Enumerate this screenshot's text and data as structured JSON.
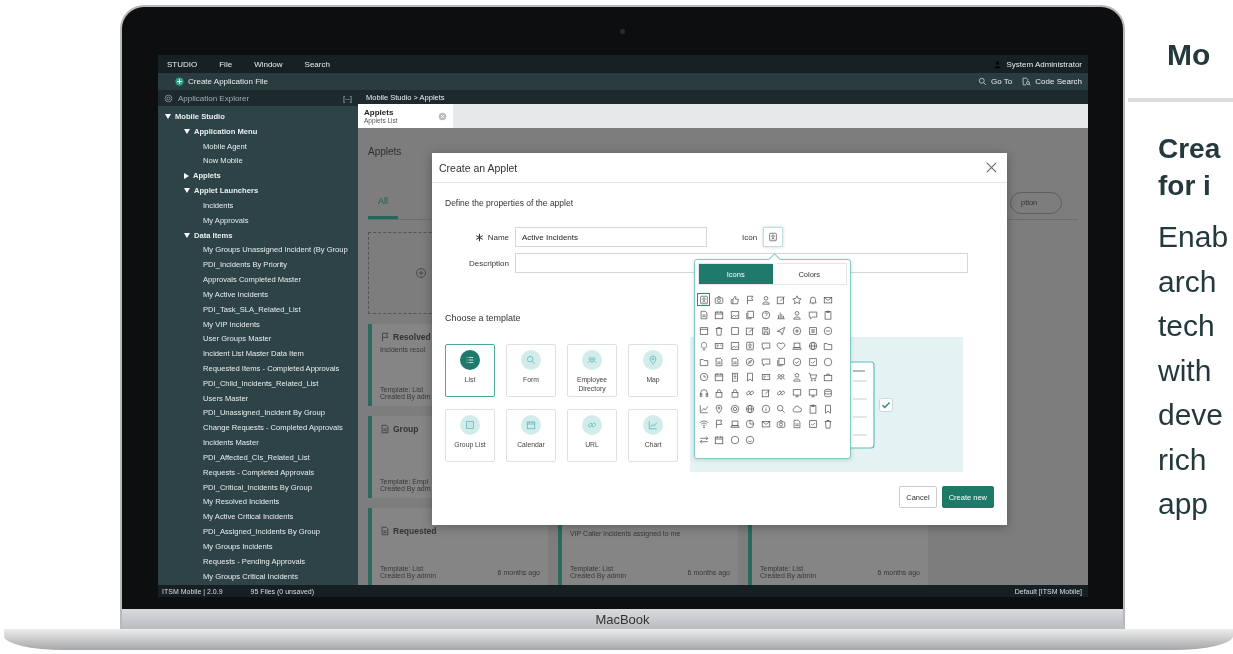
{
  "menu_bar": {
    "items": [
      "STUDIO",
      "File",
      "Window",
      "Search"
    ],
    "user": "System Administrator"
  },
  "toolbar": {
    "create": "Create Application File",
    "actions": [
      {
        "kind": "search",
        "label": "Go To"
      },
      {
        "kind": "code-search",
        "label": "Code Search"
      }
    ]
  },
  "explorer": {
    "title": "Application Explorer",
    "collapse": "[–]",
    "tree": [
      {
        "label": "Mobile Studio",
        "expanded": true,
        "children": [
          {
            "label": "Application Menu",
            "expanded": true,
            "children": [
              {
                "label": "Mobile Agent"
              },
              {
                "label": "Now Mobile"
              }
            ]
          },
          {
            "label": "Applets",
            "expanded": false
          },
          {
            "label": "Applet Launchers",
            "expanded": true,
            "children": [
              {
                "label": "Incidents"
              },
              {
                "label": "My Approvals"
              }
            ]
          },
          {
            "label": "Data Items",
            "expanded": true,
            "children": [
              {
                "label": "My Groups Unassigned Incident (By Group"
              },
              {
                "label": "PDI_Incidents By Priority"
              },
              {
                "label": "Approvals Completed Master"
              },
              {
                "label": "My Active Incidents"
              },
              {
                "label": "PDI_Task_SLA_Related_List"
              },
              {
                "label": "My VIP Incidents"
              },
              {
                "label": "User Groups Master"
              },
              {
                "label": "Incident List Master Data Item"
              },
              {
                "label": "Requested Items - Completed Approvals"
              },
              {
                "label": "PDI_Child_Incidents_Related_List"
              },
              {
                "label": "Users Master"
              },
              {
                "label": "PDI_Unassigned_Incident By Group"
              },
              {
                "label": "Change Requests - Completed Approvals"
              },
              {
                "label": "Incidents Master"
              },
              {
                "label": "PDI_Affected_CIs_Related_List"
              },
              {
                "label": "Requests - Completed Approvals"
              },
              {
                "label": "PDI_Critical_Incidents By Group"
              },
              {
                "label": "My Resolved Incidents"
              },
              {
                "label": "My Active Critical Incidents"
              },
              {
                "label": "PDI_Assigned_Incidents By Group"
              },
              {
                "label": "My Groups Incidents"
              },
              {
                "label": "Requests - Pending Approvals"
              },
              {
                "label": "My Groups Critical Incidents"
              }
            ]
          }
        ]
      }
    ]
  },
  "breadcrumb": "Mobile Studio > Applets",
  "tabs": [
    {
      "title": "Applets",
      "subtitle": "Applets List",
      "selected": true
    }
  ],
  "page": {
    "title": "Applets",
    "tabs": [
      {
        "label": "All",
        "selected": true
      }
    ],
    "search_fragment": "ption",
    "cards": [
      {
        "kind": "add"
      },
      {
        "kind": "flag",
        "title": "Resolved",
        "description": "Incidents resol",
        "template": "Template: List",
        "created": "Created By adm"
      },
      {
        "kind": "document",
        "title": "Group",
        "template": "Template: Empl",
        "created": "Created By adm"
      },
      {
        "kind": "document",
        "title": "Requested",
        "template": "Template: List",
        "created": "Created By admin",
        "age": "6 months ago"
      },
      {
        "kind": "applet",
        "description": "VIP Caller incidents assigned to me",
        "template": "Template: List",
        "created": "Created By admin",
        "age": "6 months ago"
      },
      {
        "kind": "applet",
        "template": "Template: List",
        "created": "Created By admin",
        "age": "6 months ago"
      }
    ]
  },
  "dialog": {
    "title": "Create an Applet",
    "section": "Define the properties of the applet",
    "required": true,
    "name_label": "Name",
    "name_value": "Active Incidents",
    "icon_label": "Icon",
    "description_label": "Description",
    "template_heading": "Choose a template",
    "templates": [
      {
        "label": "List",
        "kind": "lines",
        "selected": true
      },
      {
        "label": "Form",
        "kind": "search",
        "selected": false
      },
      {
        "label": "Employee Directory",
        "kind": "group",
        "selected": false
      },
      {
        "label": "Map",
        "kind": "pin",
        "selected": false
      },
      {
        "label": "Group List",
        "kind": "grid",
        "selected": false
      },
      {
        "label": "Calendar",
        "kind": "calendar",
        "selected": false
      },
      {
        "label": "URL",
        "kind": "link",
        "selected": false
      },
      {
        "label": "Chart",
        "kind": "trend",
        "selected": false
      }
    ],
    "icon_picker": {
      "tabs": [
        {
          "label": "Icons",
          "selected": true
        },
        {
          "label": "Colors",
          "selected": false
        }
      ],
      "icons": [
        {
          "kind": "contact",
          "selected": true
        },
        {
          "kind": "camera",
          "selected": false
        },
        {
          "kind": "thumbs-up",
          "selected": false
        },
        {
          "kind": "flag",
          "selected": false
        },
        {
          "kind": "person",
          "selected": false
        },
        {
          "kind": "edit",
          "selected": false
        },
        {
          "kind": "star",
          "selected": false
        },
        {
          "kind": "bell",
          "selected": false
        },
        {
          "kind": "mail",
          "selected": false
        },
        {
          "kind": "document",
          "selected": false
        },
        {
          "kind": "calendar",
          "selected": false
        },
        {
          "kind": "image",
          "selected": false
        },
        {
          "kind": "copy",
          "selected": false
        },
        {
          "kind": "help",
          "selected": false
        },
        {
          "kind": "chart",
          "selected": false
        },
        {
          "kind": "person",
          "selected": false
        },
        {
          "kind": "chat",
          "selected": false
        },
        {
          "kind": "clipboard",
          "selected": false
        },
        {
          "kind": "window",
          "selected": false
        },
        {
          "kind": "trash",
          "selected": false
        },
        {
          "kind": "square",
          "selected": false
        },
        {
          "kind": "edit",
          "selected": false
        },
        {
          "kind": "save",
          "selected": false
        },
        {
          "kind": "send",
          "selected": false
        },
        {
          "kind": "plus",
          "selected": false
        },
        {
          "kind": "list",
          "selected": false
        },
        {
          "kind": "minus",
          "selected": false
        },
        {
          "kind": "bulb",
          "selected": false
        },
        {
          "kind": "card",
          "selected": false
        },
        {
          "kind": "image",
          "selected": false
        },
        {
          "kind": "contact",
          "selected": false
        },
        {
          "kind": "chat",
          "selected": false
        },
        {
          "kind": "heart",
          "selected": false
        },
        {
          "kind": "laptop",
          "selected": false
        },
        {
          "kind": "globe",
          "selected": false
        },
        {
          "kind": "folder",
          "selected": false
        },
        {
          "kind": "folder",
          "selected": false
        },
        {
          "kind": "document",
          "selected": false
        },
        {
          "kind": "document",
          "selected": false
        },
        {
          "kind": "compass",
          "selected": false
        },
        {
          "kind": "chat",
          "selected": false
        },
        {
          "kind": "copy",
          "selected": false
        },
        {
          "kind": "check",
          "selected": false
        },
        {
          "kind": "checkbox",
          "selected": false
        },
        {
          "kind": "circle",
          "selected": false
        },
        {
          "kind": "clock",
          "selected": false
        },
        {
          "kind": "calendar",
          "selected": false
        },
        {
          "kind": "building",
          "selected": false
        },
        {
          "kind": "bookmark",
          "selected": false
        },
        {
          "kind": "card",
          "selected": false
        },
        {
          "kind": "group",
          "selected": false
        },
        {
          "kind": "person",
          "selected": false
        },
        {
          "kind": "cart",
          "selected": false
        },
        {
          "kind": "briefcase",
          "selected": false
        },
        {
          "kind": "headset",
          "selected": false
        },
        {
          "kind": "lock",
          "selected": false
        },
        {
          "kind": "lock",
          "selected": false
        },
        {
          "kind": "link",
          "selected": false
        },
        {
          "kind": "edit",
          "selected": false
        },
        {
          "kind": "link",
          "selected": false
        },
        {
          "kind": "monitor",
          "selected": false
        },
        {
          "kind": "monitor",
          "selected": false
        },
        {
          "kind": "database",
          "selected": false
        },
        {
          "kind": "trend",
          "selected": false
        },
        {
          "kind": "pin",
          "selected": false
        },
        {
          "kind": "target",
          "selected": false
        },
        {
          "kind": "globe",
          "selected": false
        },
        {
          "kind": "info",
          "selected": false
        },
        {
          "kind": "search",
          "selected": false
        },
        {
          "kind": "cloud",
          "selected": false
        },
        {
          "kind": "clipboard",
          "selected": false
        },
        {
          "kind": "bookmark",
          "selected": false
        },
        {
          "kind": "wifi",
          "selected": false
        },
        {
          "kind": "flag",
          "selected": false
        },
        {
          "kind": "laptop",
          "selected": false
        },
        {
          "kind": "pie",
          "selected": false
        },
        {
          "kind": "mail",
          "selected": false
        },
        {
          "kind": "camera",
          "selected": false
        },
        {
          "kind": "document",
          "selected": false
        },
        {
          "kind": "checkbox",
          "selected": false
        },
        {
          "kind": "trash",
          "selected": false
        },
        {
          "kind": "swap",
          "selected": false
        },
        {
          "kind": "calendar",
          "selected": false
        },
        {
          "kind": "circle",
          "selected": false
        },
        {
          "kind": "smiley",
          "selected": false
        }
      ]
    },
    "buttons": [
      {
        "label": "Cancel",
        "kind": "secondary"
      },
      {
        "label": "Create new",
        "kind": "primary"
      }
    ]
  },
  "status_bar": {
    "left": [
      "ITSM Mobile | 2.0.9",
      "95 Files (0 unsaved)"
    ],
    "right": "Default [ITSM Mobile]"
  },
  "device": {
    "label": "MacBook"
  },
  "promo": {
    "heading": "Mo",
    "subheading_lines": [
      "Crea",
      "for i"
    ],
    "body_lines": [
      "Enab",
      "arch",
      "tech",
      "with",
      "deve",
      "rich",
      "app"
    ]
  }
}
